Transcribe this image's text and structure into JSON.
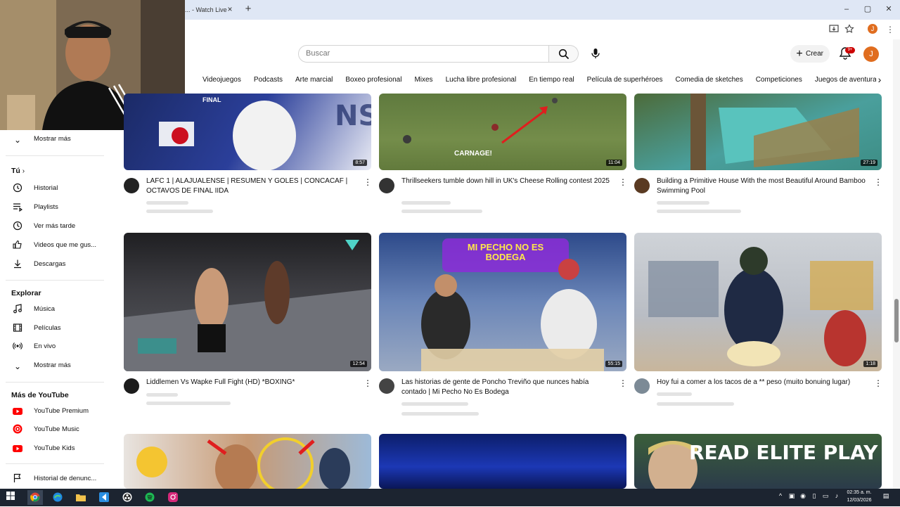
{
  "browser": {
    "tab_title": "... - Watch Live",
    "tab_close": "×",
    "new_tab": "+",
    "profile_initial": "J",
    "window_controls": [
      "–",
      "▢",
      "✕"
    ]
  },
  "header": {
    "search_placeholder": "Buscar",
    "create_label": "Crear",
    "notifications_badge": "9+",
    "avatar_initial": "J"
  },
  "chips": [
    "Videojuegos",
    "Podcasts",
    "Arte marcial",
    "Boxeo profesional",
    "Mixes",
    "Lucha libre profesional",
    "En tiempo real",
    "Película de superhéroes",
    "Comedia de sketches",
    "Competiciones",
    "Juegos de aventura"
  ],
  "sidebar": {
    "show_more_1": "Mostrar más",
    "you_heading": "Tú",
    "you_items": [
      {
        "label": "Historial",
        "icon": "history-icon"
      },
      {
        "label": "Playlists",
        "icon": "playlists-icon"
      },
      {
        "label": "Ver más tarde",
        "icon": "watch-later-icon"
      },
      {
        "label": "Videos que me gus...",
        "icon": "liked-icon"
      },
      {
        "label": "Descargas",
        "icon": "download-icon"
      }
    ],
    "explore_heading": "Explorar",
    "explore_items": [
      {
        "label": "Música",
        "icon": "music-icon"
      },
      {
        "label": "Películas",
        "icon": "movies-icon"
      },
      {
        "label": "En vivo",
        "icon": "live-icon"
      }
    ],
    "show_more_2": "Mostrar más",
    "more_heading": "Más de YouTube",
    "more_items": [
      {
        "label": "YouTube Premium",
        "icon": "youtube-premium-icon"
      },
      {
        "label": "YouTube Music",
        "icon": "youtube-music-icon"
      },
      {
        "label": "YouTube Kids",
        "icon": "youtube-kids-icon"
      }
    ],
    "report_history": "Historial de denunc..."
  },
  "videos": {
    "row1": [
      {
        "title": "LAFC 1 | ALAJUALENSE | RESUMEN Y GOLES | CONCACAF | OCTAVOS DE FINAL IIDA",
        "duration": "8:57",
        "overlay": "FINAL"
      },
      {
        "title": "Thrillseekers tumble down hill in UK's Cheese Rolling contest 2025",
        "duration": "11:04",
        "overlay": "CARNAGE!"
      },
      {
        "title": "Building a Primitive House With the most Beautiful Around Bamboo Swimming Pool",
        "duration": "27:19",
        "overlay": ""
      }
    ],
    "row2": [
      {
        "title": "Liddlemen Vs Wapke Full Fight (HD) *BOXING*",
        "duration": "12:54",
        "overlay": ""
      },
      {
        "title": "Las historias de gente de Poncho Treviño que nunces había contado | Mi Pecho No Es Bodega",
        "duration": "55:15",
        "overlay": "MI PECHO NO ES BODEGA"
      },
      {
        "title": "Hoy fui a comer a los tacos de a ** peso (muito bonuing lugar)",
        "duration": "1:18",
        "overlay": ""
      }
    ],
    "row3": [
      {
        "title": "",
        "duration": "",
        "overlay": ""
      },
      {
        "title": "",
        "duration": "",
        "overlay": ""
      },
      {
        "title": "",
        "duration": "",
        "overlay": "READ ELITE PLAY INS"
      }
    ]
  },
  "taskbar": {
    "time": "02:35 a. m.",
    "date": "12/03/2026"
  },
  "colors": {
    "youtube_red": "#ff0000",
    "accent_orange": "#e06d1f",
    "taskbar_bg": "#1c2430"
  }
}
